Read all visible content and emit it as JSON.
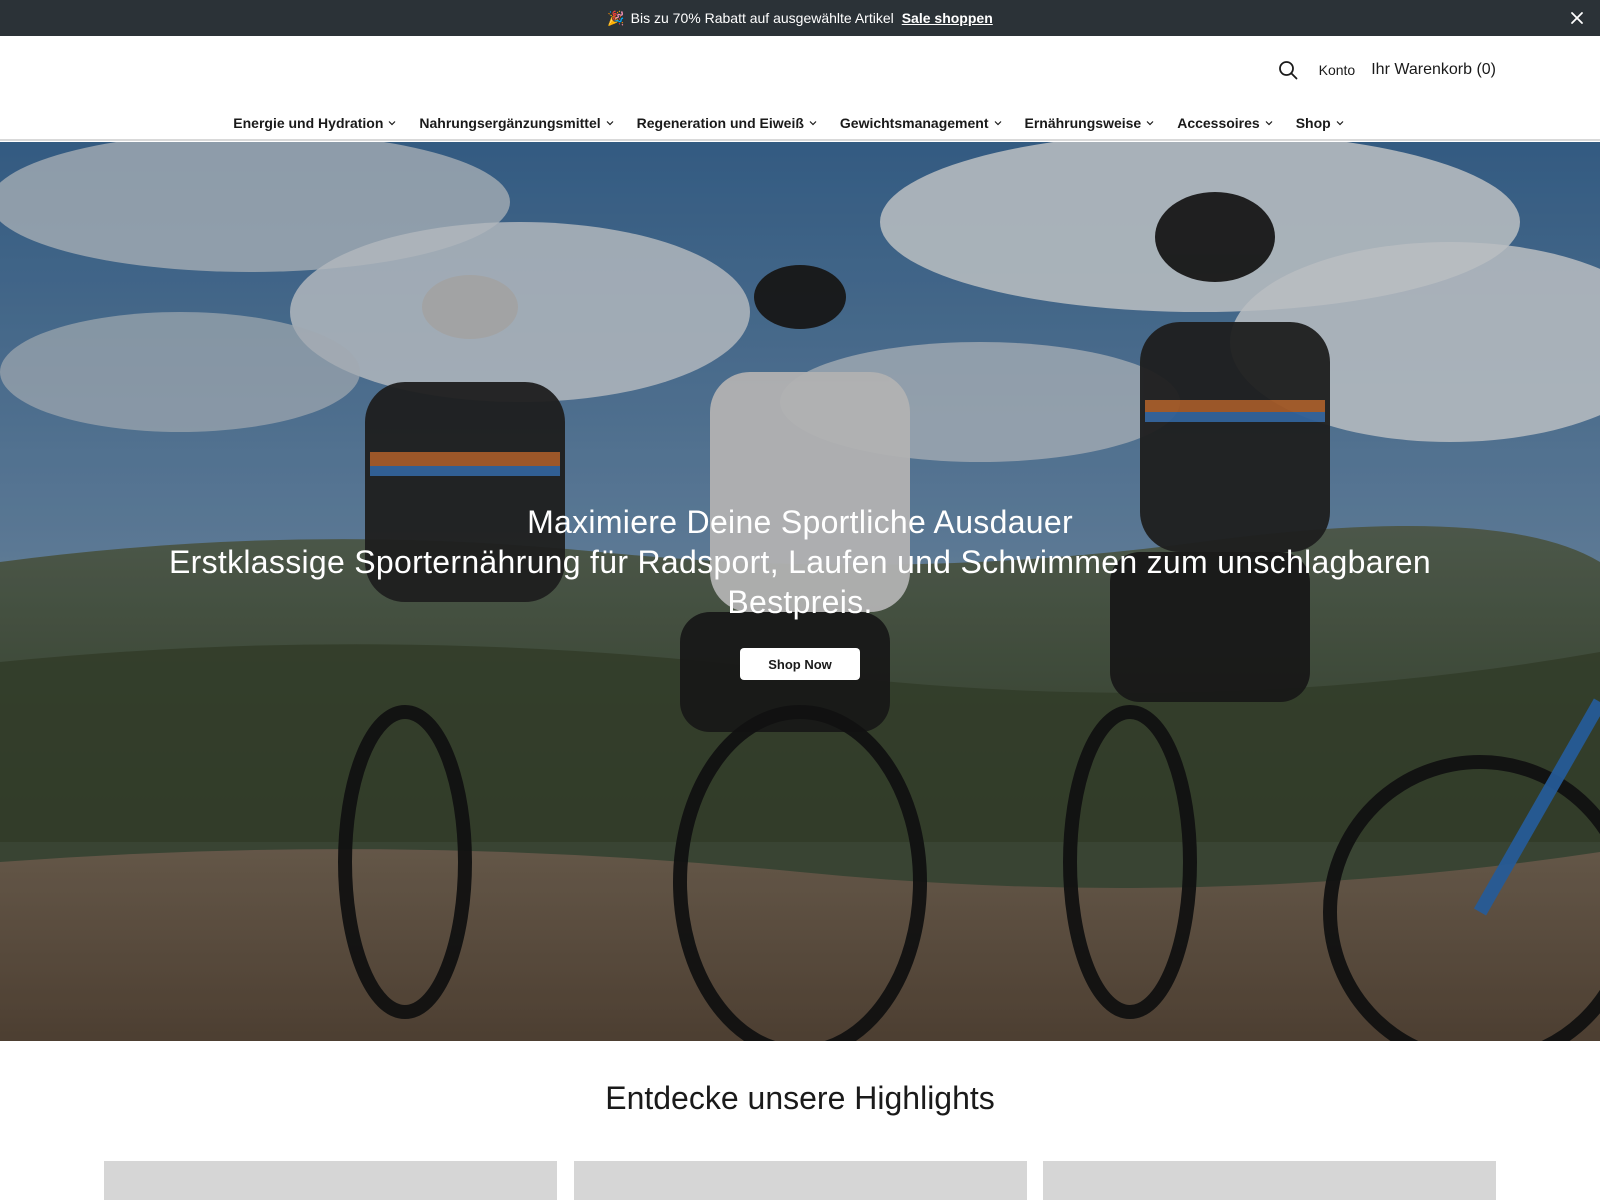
{
  "announcement": {
    "emoji": "🎉",
    "message": "Bis zu 70% Rabatt auf ausgewählte Artikel",
    "link_label": "Sale shoppen",
    "close_icon": "close-icon"
  },
  "header": {
    "search_icon": "search-icon",
    "account_label": "Konto",
    "cart_label": "Ihr Warenkorb (0)"
  },
  "nav": {
    "items": [
      {
        "label": "Energie und Hydration"
      },
      {
        "label": "Nahrungsergänzungsmittel"
      },
      {
        "label": "Regeneration und Eiweiß"
      },
      {
        "label": "Gewichtsmanagement"
      },
      {
        "label": "Ernährungsweise"
      },
      {
        "label": "Accessoires"
      },
      {
        "label": "Shop"
      }
    ],
    "chevron_icon": "chevron-down-icon"
  },
  "hero": {
    "title": "Maximiere Deine Sportliche Ausdauer",
    "subtitle": "Erstklassige Sporternährung für Radsport, Laufen und Schwimmen zum unschlagbaren Bestpreis.",
    "button_label": "Shop Now"
  },
  "highlights": {
    "title": "Entdecke unsere Highlights",
    "card_count": 3
  },
  "colors": {
    "announcement_bg": "#2b3237",
    "card_placeholder": "#d6d6d6",
    "text": "#1a1a1a"
  }
}
